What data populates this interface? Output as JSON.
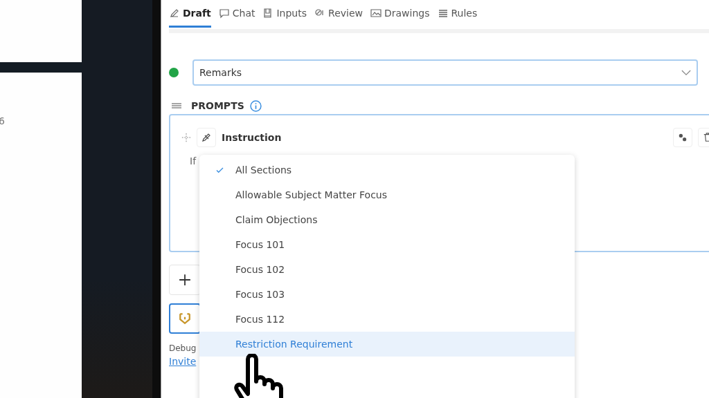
{
  "left_panel": {
    "number": "6"
  },
  "tabs": [
    {
      "label": "Draft",
      "selected": true
    },
    {
      "label": "Chat",
      "selected": false
    },
    {
      "label": "Inputs",
      "selected": false
    },
    {
      "label": "Review",
      "selected": false
    },
    {
      "label": "Drawings",
      "selected": false
    },
    {
      "label": "Rules",
      "selected": false
    }
  ],
  "section_select": {
    "value": "Remarks"
  },
  "prompts": {
    "title": "PROMPTS"
  },
  "prompt_card": {
    "title": "Instruction",
    "body_text": "If"
  },
  "debug_label": "Debug",
  "invite_link": "Invite",
  "section_menu": [
    {
      "label": "All Sections",
      "selected": true,
      "highlighted": false
    },
    {
      "label": "Allowable Subject Matter Focus",
      "selected": false,
      "highlighted": false
    },
    {
      "label": "Claim Objections",
      "selected": false,
      "highlighted": false
    },
    {
      "label": "Focus 101",
      "selected": false,
      "highlighted": false
    },
    {
      "label": "Focus 102",
      "selected": false,
      "highlighted": false
    },
    {
      "label": "Focus 103",
      "selected": false,
      "highlighted": false
    },
    {
      "label": "Focus 112",
      "selected": false,
      "highlighted": false
    },
    {
      "label": "Restriction Requirement",
      "selected": false,
      "highlighted": true
    }
  ]
}
